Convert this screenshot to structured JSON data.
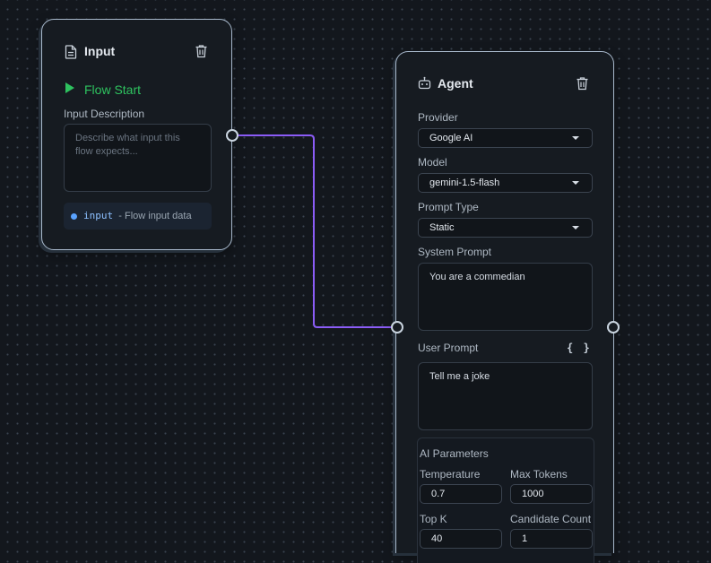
{
  "input_node": {
    "title": "Input",
    "flow_start": "Flow Start",
    "description_label": "Input Description",
    "description_placeholder": "Describe what input this flow expects...",
    "io_name": "input",
    "io_description": "- Flow input data"
  },
  "agent_node": {
    "title": "Agent",
    "provider_label": "Provider",
    "provider_value": "Google AI",
    "model_label": "Model",
    "model_value": "gemini-1.5-flash",
    "prompt_type_label": "Prompt Type",
    "prompt_type_value": "Static",
    "system_prompt_label": "System Prompt",
    "system_prompt_value": "You are a commedian",
    "user_prompt_label": "User Prompt",
    "user_prompt_braces": "{ }",
    "user_prompt_value": "Tell me a joke",
    "params_title": "AI Parameters",
    "temperature_label": "Temperature",
    "temperature_value": "0.7",
    "max_tokens_label": "Max Tokens",
    "max_tokens_value": "1000",
    "top_k_label": "Top K",
    "top_k_value": "40",
    "candidate_count_label": "Candidate Count",
    "candidate_count_value": "1"
  },
  "colors": {
    "background": "#13171d",
    "node_border": "#a8b9cc",
    "connection": "#8b5cf6",
    "flow_start": "#2ec25f",
    "io_accent": "#5aa3ff"
  },
  "icons": [
    "document-icon",
    "trash-icon",
    "play-icon",
    "robot-icon"
  ]
}
